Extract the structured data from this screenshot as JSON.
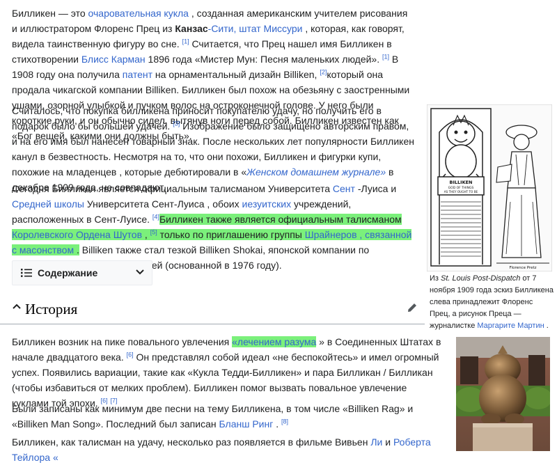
{
  "p1": {
    "t1": "Билликен — это ",
    "l1": "очаровательная кукла",
    "t2": " , созданная американским учителем рисования и иллюстратором Флоренс Прец из ",
    "b1": "Канзас",
    "l2": "-Сити, штат Миссури",
    "t3": " , которая, как говорят, видела таинственную фигуру во сне. ",
    "s1": "[1]",
    "t4": " Считается, что Прец нашел имя Билликен в стихотворении ",
    "l3": "Блисс Карман",
    "t5": " 1896 года «Мистер Мун: Песня маленьких людей». ",
    "s2": "[1]",
    "t6": " В 1908 году она получила ",
    "l4": "патент",
    "t7": " на орнаментальный дизайн Billiken, ",
    "s3": "[2]",
    "t8": "который она продала чикагской компании Billiken. Билликен был похож на обезьяну с заостренными ушами, озорной улыбкой и пучком волос на остроконечной голове. У него были короткие руки, и он обычно сидел, вытянув ноги перед собой. Билликен известен как «Бог вещей, какими они должны быть»."
  },
  "p2": {
    "t1": "Считалось, что покупка билликена приносит покупателю удачу, но получить его в подарок было бы большей удачей. ",
    "s1": "[3]",
    "t2": " Изображение было защищено авторским правом, и на его имя был нанесен товарный знак. После нескольких лет популярности Билликен канул в безвестность. Несмотря на то, что они похожи, Билликен и фигурки купи, похожие на младенцев , которые дебютировали в «",
    "l1": "Женском домашнем журнале»",
    "t3": " в декабре 1909 года, не совпадают."
  },
  "p3": {
    "t1": "Сегодня Билликен является официальным талисманом Университета ",
    "l1": "Сент",
    "t2": " -Луиса и ",
    "l2": "Средней школы",
    "t3": " Университета Сент-Луиса , обоих ",
    "l3": "иезуитских",
    "t4": " учреждений, расположенных в Сент-Луисе. ",
    "s1": "[4]",
    "h1": "Билликен также является официальным талисманом ",
    "l4": "Королевского Ордена Шутов",
    "h2": " , ",
    "s2": "[5]",
    "h3": " только по приглашению группы ",
    "l5": "Шрайнеров , связанной с масонством",
    "h4": " .",
    "t5": " Billiken также стал тезкой Billiken Shokai, японской компании по производству игрушек и моделей (основанной в 1976 году)."
  },
  "toc": {
    "label": "Содержание"
  },
  "section": {
    "title": "История"
  },
  "p4": {
    "t1": "Билликен возник на пике повального увлечения ",
    "l1": "«лечением разума",
    "t2": " » в Соединенных Штатах в начале двадцатого века. ",
    "s1": "[6]",
    "t3": " Он представлял собой идеал «не беспокойтесь» и имел огромный успех. Появились вариации, такие как «Кукла Тедди-Билликен» и пара Билликан / Билликан (чтобы избавиться от мелких проблем). Билликен помог вызвать повальное увлечение куклами той эпохи. ",
    "s2": "[6]",
    "s3": "[7]"
  },
  "p5": {
    "t1": "Были записаны как минимум две песни на тему Билликена, в том числе «Billiken Rag» и «Billiken Man Song». Последний был записан ",
    "l1": "Бланш Ринг",
    "t2": " . ",
    "s1": "[8]"
  },
  "p6": {
    "t1": "Билликен, как талисман на удачу, несколько раз появляется в фильме Вивьен ",
    "l1": "Ли",
    "t2": " и ",
    "l2": "Роберта Тейлора «"
  },
  "figure1": {
    "cap1": "Из ",
    "cap_it": "St. Louis Post-Dispatch",
    "cap2": " от 7 ноября 1909 года эскиз Билликена слева принадлежит Флоренс Прец, а рисунок Преца — журналистке ",
    "cap_link": "Маргарите Мартин",
    "cap3": " .",
    "sign_l1": "BILLIKEN",
    "sign_l2": "GOD OF THINGS",
    "sign_l3": "AS THEY OUGHT TO BE",
    "signature": "Florence Pretz"
  }
}
